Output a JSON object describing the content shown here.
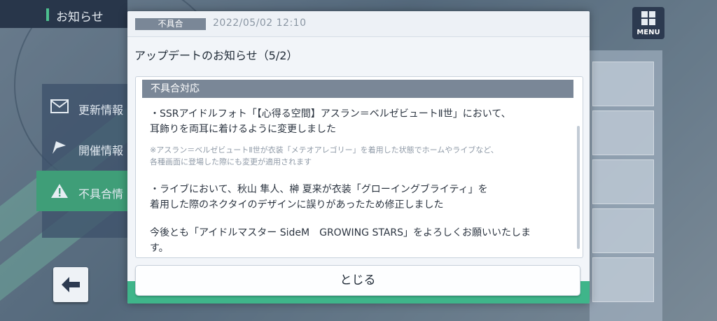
{
  "header": {
    "title": "お知らせ"
  },
  "sidebar": {
    "items": [
      {
        "label": "更新情報",
        "icon": "mail-icon"
      },
      {
        "label": "開催情報",
        "icon": "flag-icon"
      },
      {
        "label": "不具合情",
        "icon": "warning-icon",
        "active": true
      }
    ]
  },
  "menu": {
    "label": "MENU"
  },
  "modal": {
    "badge": "不具合",
    "date": "2022/05/02 12:10",
    "title": "アップデートのお知らせ（5/2）",
    "section_heading": "不具合対応",
    "paragraphs": {
      "p1_line1": "・SSRアイドルフォト「【心得る空間】アスラン＝ベルゼビュートⅡ世」において、",
      "p1_line2": "耳飾りを両耳に着けるように変更しました",
      "note_line1": "※アスラン＝ベルゼビュートⅡ世が衣装「メテオアレゴリー」を着用した状態でホームやライブなど、",
      "note_line2": "各種画面に登場した際にも変更が適用されます",
      "p2_line1": "・ライブにおいて、秋山 隼人、榊 夏来が衣装「グローイングブライティ」を",
      "p2_line2": "着用した際のネクタイのデザインに誤りがあったため修正しました",
      "closing_line1": "今後とも「アイドルマスター SideM　GROWING STARS」をよろしくお願いいたしま",
      "closing_line2": "す。"
    },
    "close_label": "とじる"
  },
  "colors": {
    "accent_green": "#3fb58a",
    "badge_gray": "#7a8797",
    "header_navy": "#28364a"
  }
}
